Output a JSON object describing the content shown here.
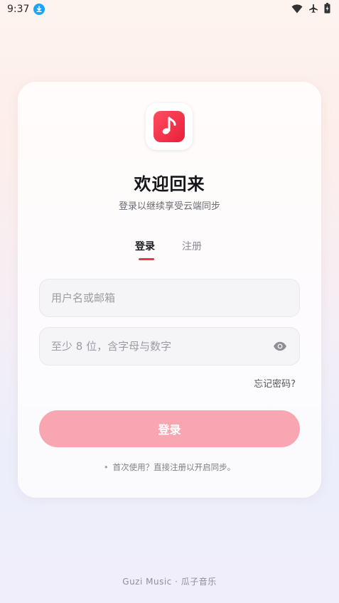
{
  "status_bar": {
    "time": "9:37",
    "icons": [
      "download-icon",
      "wifi-icon",
      "airplane-mode-icon",
      "battery-icon"
    ]
  },
  "login_card": {
    "logo_icon": "music-note-icon",
    "title": "欢迎回来",
    "subtitle": "登录以继续享受云端同步",
    "tabs": [
      {
        "label": "登录",
        "active": true
      },
      {
        "label": "注册",
        "active": false
      }
    ],
    "username_field": {
      "placeholder": "用户名或邮箱",
      "value": ""
    },
    "password_field": {
      "placeholder": "至少 8 位，含字母与数字",
      "value": "",
      "toggle_icon": "eye-icon"
    },
    "forgot_password": "忘记密码?",
    "login_button": "登录",
    "hint": "首次使用？直接注册以开启同步。"
  },
  "footer": "Guzi Music · 瓜子音乐",
  "colors": {
    "accent": "#f0324a",
    "button_disabled": "#f8a6b1",
    "logo_gradient_start": "#ff4d61",
    "logo_gradient_end": "#e8203a",
    "download_badge": "#1aa3ff"
  }
}
